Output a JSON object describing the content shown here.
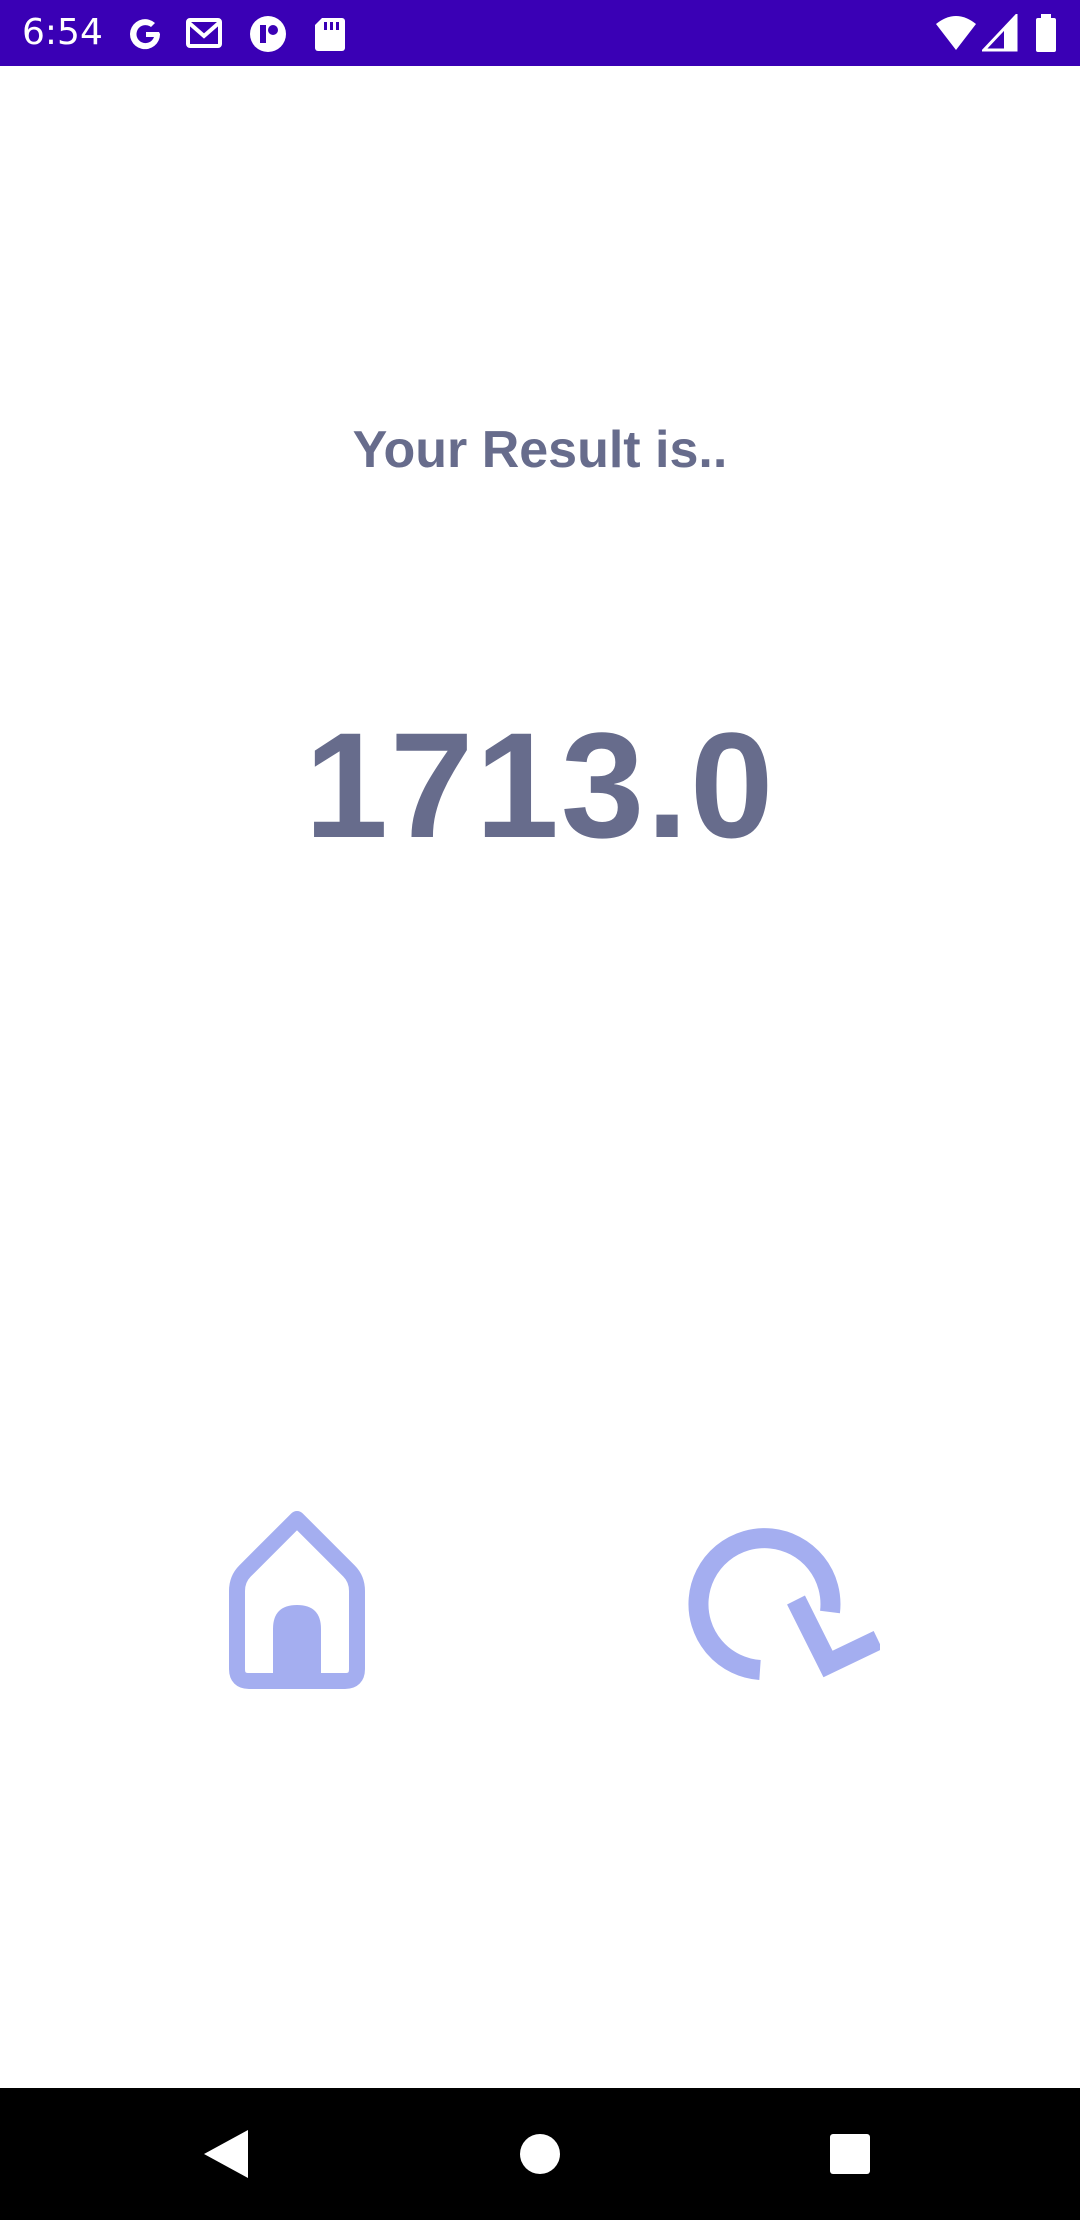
{
  "status_bar": {
    "time": "6:54",
    "left_icons": [
      "google-icon",
      "gmail-icon",
      "app-icon",
      "sd-card-icon"
    ],
    "right_icons": [
      "wifi-icon",
      "signal-icon",
      "battery-icon"
    ],
    "background_color": "#3a00b5"
  },
  "result": {
    "heading": "Your Result is..",
    "value": "1713.0",
    "text_color": "#676c8c"
  },
  "actions": {
    "home_icon": "home-icon",
    "retry_icon": "retry-icon",
    "icon_color": "#a4aef0"
  },
  "nav_bar": {
    "buttons": [
      "back-icon",
      "home-circle-icon",
      "recents-icon"
    ]
  }
}
